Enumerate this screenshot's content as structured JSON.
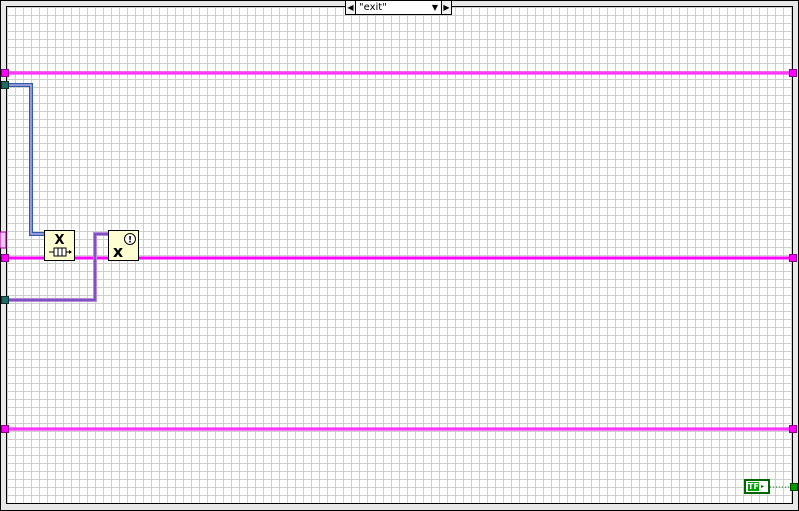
{
  "case_structure": {
    "selector_value": "\"exit\"",
    "decrement_arrow": "◀",
    "dropdown_arrow": "▼",
    "increment_arrow": "▶"
  },
  "nodes": {
    "release_queue": {
      "icon": "release-queue-icon",
      "glyph": "X"
    },
    "simple_error_handler": {
      "icon": "error-handler-icon",
      "glyph": "x",
      "badge": "!"
    }
  },
  "constants": {
    "boolean": {
      "label": "TF",
      "value": "true",
      "color": "#00a000"
    }
  },
  "colors": {
    "class_wire": "#ff00ff",
    "refnum_wire": "#2d5fa8",
    "error_wire": "#b88cd8",
    "boolean_wire": "#008000",
    "node_background": "#fffdd2"
  }
}
